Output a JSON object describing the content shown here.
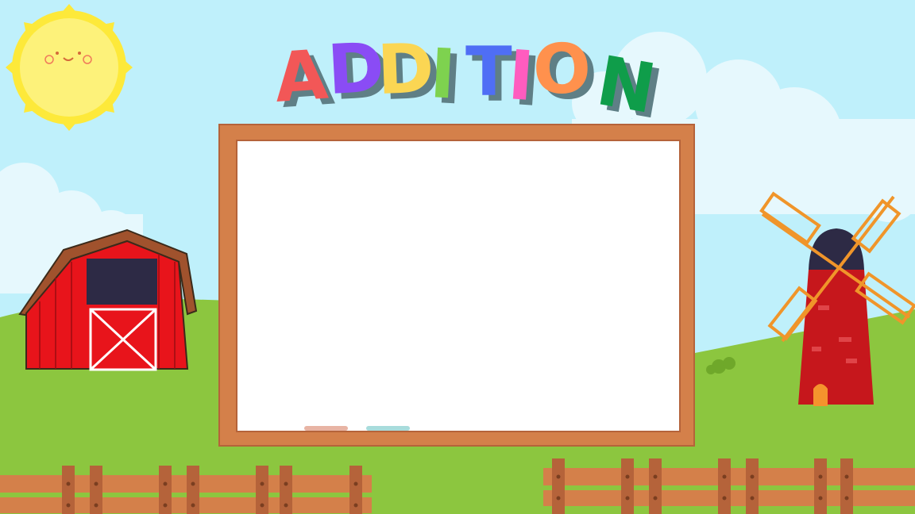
{
  "title": {
    "text": "ADDITION",
    "letters": [
      {
        "char": "A",
        "color": "#f25757"
      },
      {
        "char": "D",
        "color": "#8a4cf5"
      },
      {
        "char": "D",
        "color": "#fbd653"
      },
      {
        "char": "I",
        "color": "#7ed24f"
      },
      {
        "char": "T",
        "color": "#4f6ef5"
      },
      {
        "char": "I",
        "color": "#ff5cbf"
      },
      {
        "char": "O",
        "color": "#ff914d"
      },
      {
        "char": "N",
        "color": "#0f9d4a"
      }
    ],
    "shadow_color": "#5f7f86"
  },
  "colors": {
    "sky": "#bff0fb",
    "cloud": "#e8f8fd",
    "grass": "#8cc63f",
    "grass_dark": "#7ab32e",
    "frame": "#d4804a",
    "frame_dark": "#b5633a",
    "board": "#ffffff",
    "sun": "#fdf06a",
    "barn": "#e8141b",
    "roof": "#a0522d",
    "windmill_top": "#2d2a45"
  },
  "board": {
    "chalk_colors": [
      "#e8b4a4",
      "#a8dcdc"
    ]
  }
}
